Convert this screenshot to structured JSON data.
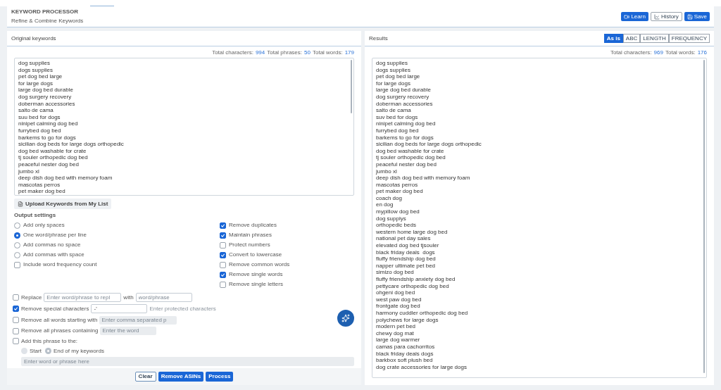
{
  "header": {
    "title": "KEYWORD PROCESSOR",
    "subtitle": "Refine & Combine Keywords",
    "buttons": [
      {
        "label": "Learn",
        "kind": "primary"
      },
      {
        "label": "History",
        "kind": "outline"
      },
      {
        "label": "Save",
        "kind": "primary"
      }
    ]
  },
  "original": {
    "title": "Original keywords",
    "stats": [
      {
        "label": "Total characters:",
        "value": "994"
      },
      {
        "label": "Total phrases:",
        "value": "50"
      },
      {
        "label": "Total words:",
        "value": "179"
      }
    ],
    "keywords": [
      "dog supplies",
      "dogs supplies",
      "pet dog bed large",
      "for large dogs",
      "large dog bed durable",
      "dog surgery recovery",
      "doberman accessories",
      "salto de cama",
      "suu bed for dogs",
      "ninipet calming dog bed",
      "furrybed dog bed",
      "barkems to go for dogs",
      "sicilian dog beds for large dogs orthopedic",
      "dog bed washable for crate",
      "tj souler orthopedic dog bed",
      "peaceful nester dog bed",
      "jumbo xl",
      "deep dish dog bed with memory foam",
      "mascotas perros",
      "pet maker dog bed"
    ],
    "upload_button": "Upload Keywords from My List"
  },
  "output_settings": {
    "title": "Output settings",
    "formats": [
      {
        "label": "Add only spaces",
        "selected": false
      },
      {
        "label": "One word/phrase per line",
        "selected": true
      },
      {
        "label": "Add commas no space",
        "selected": false
      },
      {
        "label": "Add commas with space",
        "selected": false
      }
    ],
    "frequency": {
      "label": "Include word frequency count",
      "checked": false
    },
    "options": [
      {
        "label": "Remove duplicates",
        "checked": true
      },
      {
        "label": "Maintain phrases",
        "checked": true
      },
      {
        "label": "Protect numbers",
        "checked": false
      },
      {
        "label": "Convert to lowercase",
        "checked": true
      },
      {
        "label": "Remove common words",
        "checked": false
      },
      {
        "label": "Remove single words",
        "checked": true
      },
      {
        "label": "Remove single letters",
        "checked": false
      }
    ],
    "replace": {
      "label": "Replace",
      "checked": false,
      "placeholder": "Enter word/phrase to repl",
      "with": "with",
      "with_placeholder": "word/phrase"
    },
    "special": {
      "label": "Remove special characters",
      "checked": true,
      "value": "-'",
      "hint": "Enter protected characters"
    },
    "starting": {
      "label": "Remove all words starting with",
      "checked": false,
      "placeholder": "Enter comma separated p"
    },
    "containing": {
      "label": "Remove all phrases containing",
      "checked": false,
      "placeholder": "Enter the word"
    },
    "add_phrase": {
      "label": "Add this phrase to the:",
      "checked": false,
      "positions": [
        {
          "label": "Start",
          "selected": false
        },
        {
          "label": "End of my keywords",
          "selected": true
        }
      ],
      "placeholder": "Enter word or phrase here"
    }
  },
  "actions": [
    {
      "label": "Clear",
      "kind": "outline"
    },
    {
      "label": "Remove ASINs",
      "kind": "primary"
    },
    {
      "label": "Process",
      "kind": "primary"
    }
  ],
  "results": {
    "title": "Results",
    "sorts": [
      {
        "label": "As is",
        "selected": true
      },
      {
        "label": "ABC",
        "selected": false
      },
      {
        "label": "LENGTH",
        "selected": false
      },
      {
        "label": "FREQUENCY",
        "selected": false
      }
    ],
    "stats": [
      {
        "label": "Total characters:",
        "value": "969"
      },
      {
        "label": "Total words:",
        "value": "176"
      }
    ],
    "keywords": [
      "dog supplies",
      "dogs supplies",
      "pet dog bed large",
      "for large dogs",
      "large dog bed durable",
      "dog surgery recovery",
      "doberman accessories",
      "salto de cama",
      "suv bed for dogs",
      "ninipet calming dog bed",
      "furrybed dog bed",
      "barkems to go for dogs",
      "sicilian dog beds for large dogs orthopedic",
      "dog bed washable for crate",
      "tj souler orthopedic dog bed",
      "peaceful nester dog bed",
      "jumbo xl",
      "deep dish dog bed with memory foam",
      "mascotas perros",
      "pet maker dog bed",
      "coach dog",
      "en dog",
      "mypillow dog bed",
      "dog supplys",
      "orthopedic beds",
      "western home large dog bed",
      "national pet day sales",
      "elevated dog bed tjsouler",
      "black friday deals  dogs",
      "fluffy friendship dog bed",
      "napper ultimate pet bed",
      "simizo dog bed",
      "fluffy friendship anxiety dog bed",
      "pettycare orthopedic dog bed",
      "ohgeni dog bed",
      "west paw dog bed",
      "frontgate dog bed",
      "harmony cuddler orthopedic dog bed",
      "polychews for large dogs",
      "modern pet bed",
      "chewy dog mat",
      "large dog warmer",
      "camas para cachorritos",
      "black friday deals dogs",
      "barkbox soft plush bed",
      "dog crate accessories for large dogs"
    ]
  }
}
